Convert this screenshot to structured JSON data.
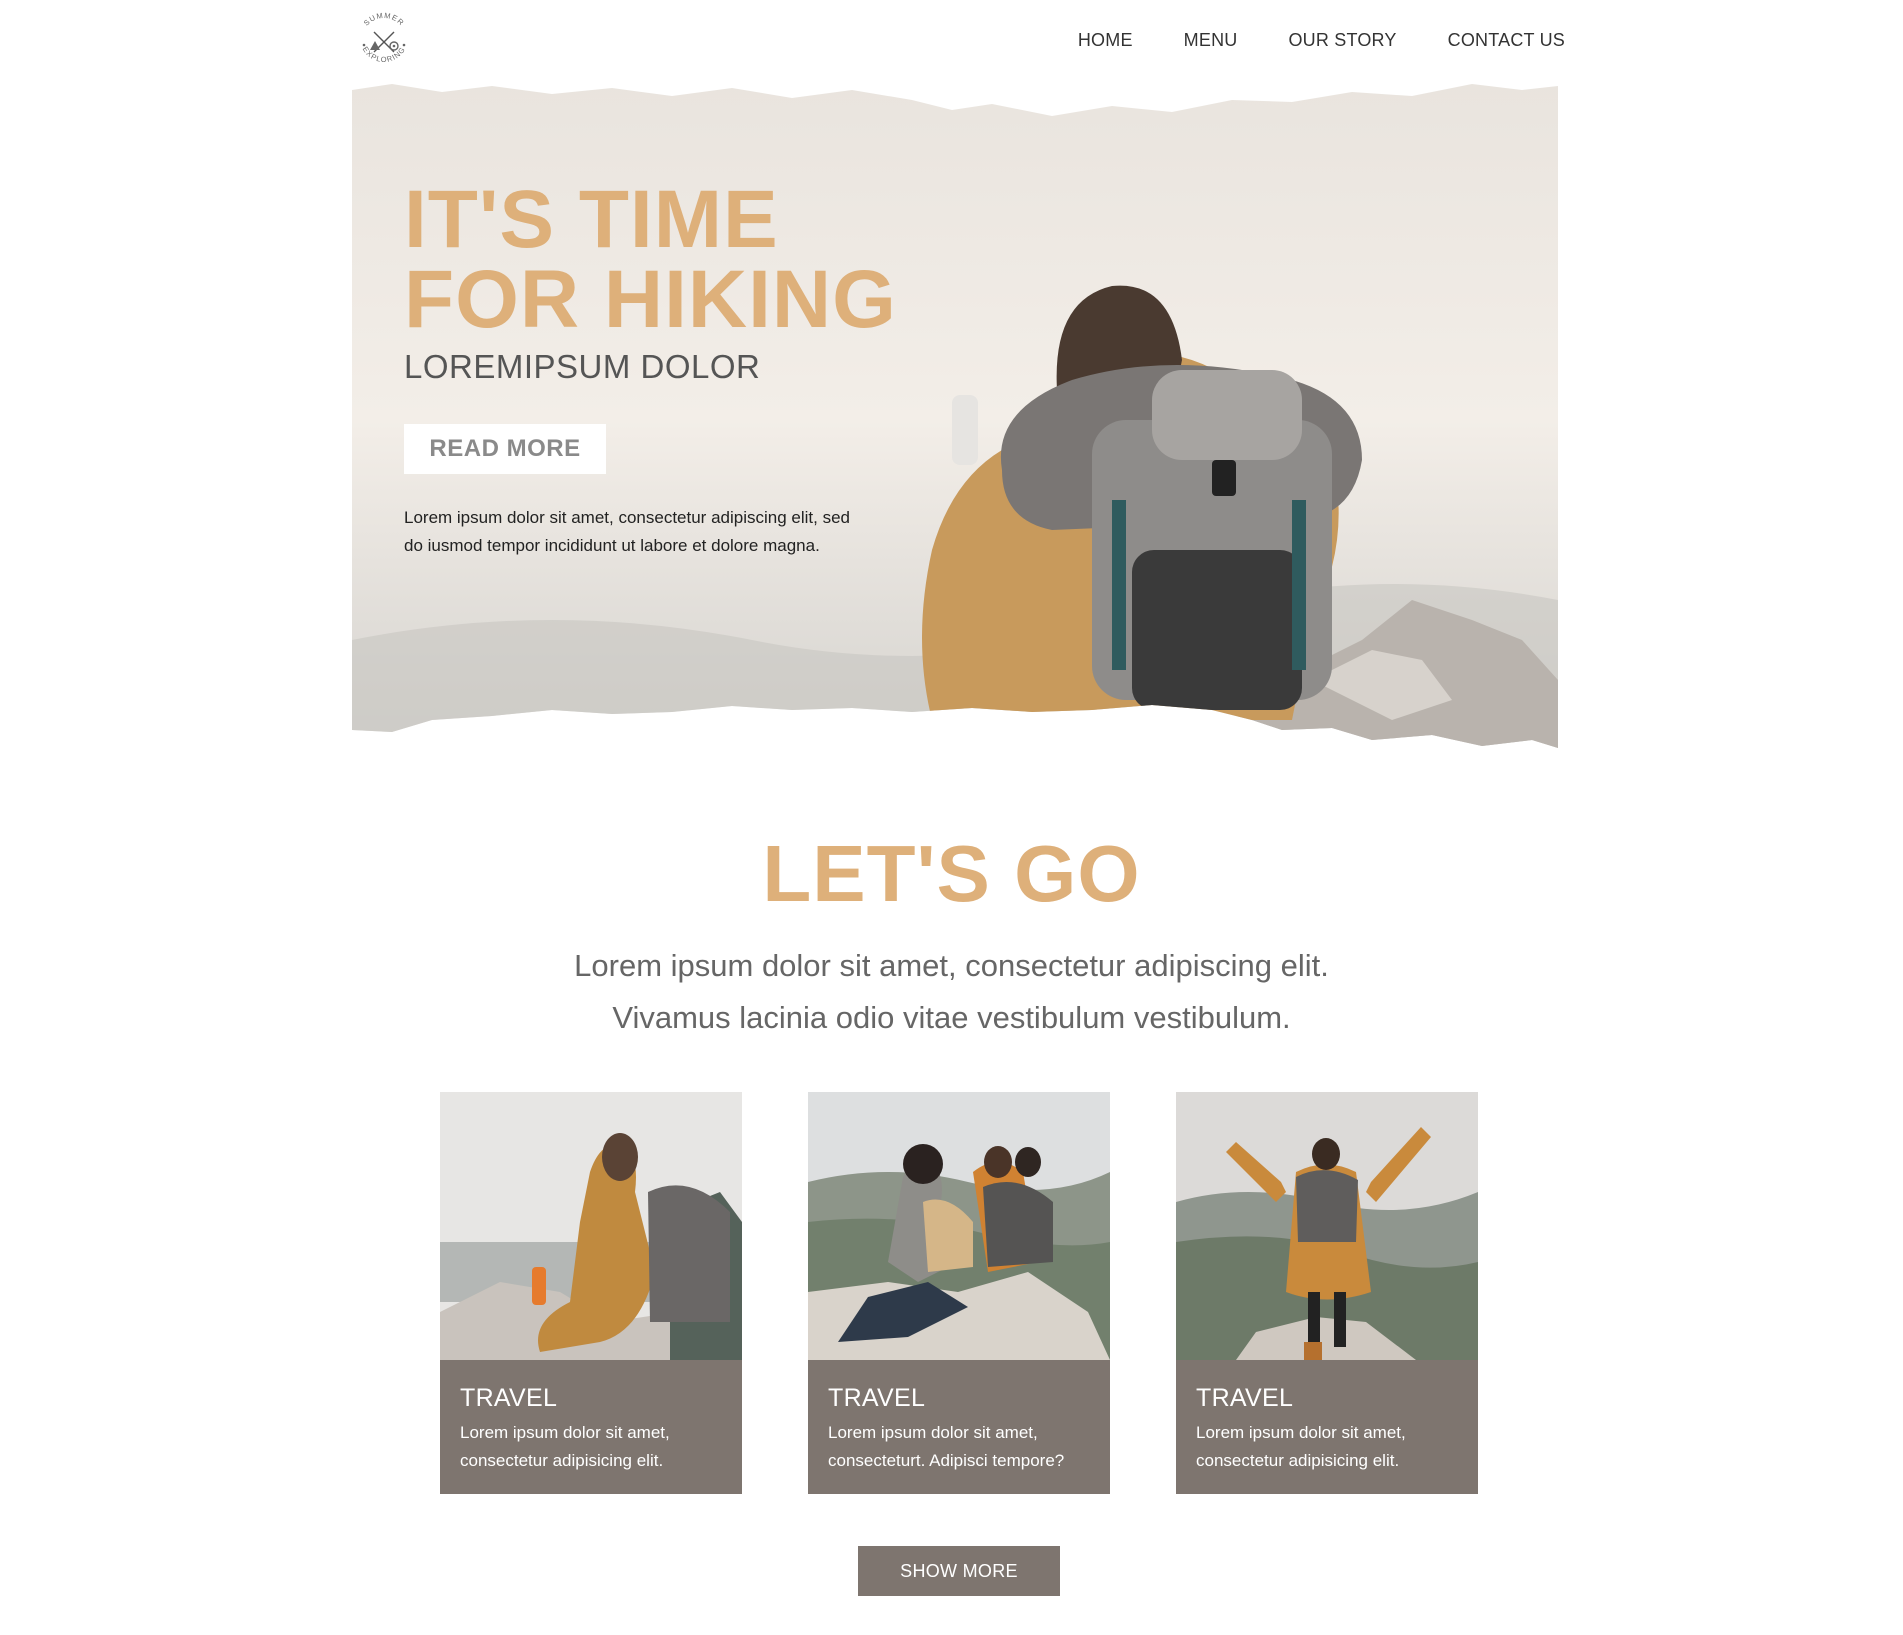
{
  "brand": {
    "logo_text_top": "SUMMER",
    "logo_text_bottom": "EXPLORING"
  },
  "nav": {
    "items": [
      "HOME",
      "MENU",
      "OUR STORY",
      "CONTACT US"
    ]
  },
  "hero": {
    "title_line1": "IT'S TIME",
    "title_line2": "FOR HIKING",
    "subtitle": "LOREMIPSUM DOLOR",
    "button_label": "READ MORE",
    "text": "Lorem ipsum dolor sit amet, consectetur adipiscing elit, sed do iusmod tempor incididunt ut labore et dolore magna."
  },
  "section": {
    "title": "LET'S GO",
    "line1": "Lorem ipsum dolor sit amet, consectetur adipiscing elit.",
    "line2": "Vivamus lacinia odio vitae vestibulum vestibulum."
  },
  "cards": [
    {
      "title": "TRAVEL",
      "text": "Lorem ipsum dolor sit amet, consectetur adipisicing elit."
    },
    {
      "title": "TRAVEL",
      "text": "Lorem ipsum dolor sit amet, consecteturt. Adipisci tempore?"
    },
    {
      "title": "TRAVEL",
      "text": "Lorem ipsum dolor sit amet, consectetur adipisicing elit."
    }
  ],
  "show_more_label": "SHOW MORE",
  "colors": {
    "accent": "#deb07a",
    "card_bg": "#7e756f",
    "text_gray": "#666666"
  }
}
